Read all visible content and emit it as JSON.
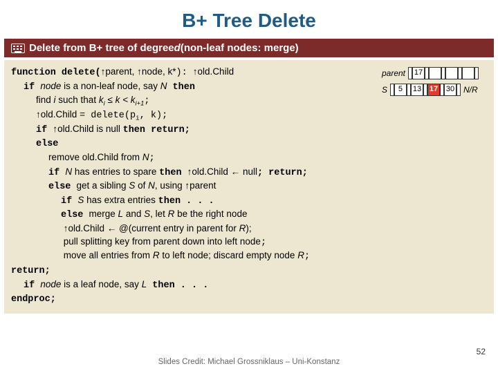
{
  "title": "B+ Tree Delete",
  "section": {
    "prefix": "Delete from B+ tree of degree ",
    "degree": "d",
    "suffix": " (non-leaf nodes: merge)"
  },
  "code": {
    "l1a": "function delete(",
    "l1b": "↑parent",
    "l1c": ", ",
    "l1d": "↑node",
    "l1e": ", k*",
    "l1f": "): ",
    "l1g": "↑old.Child",
    "l2a": "if ",
    "l2b": "node",
    "l2c": " is a non-leaf node, say ",
    "l2d": "N",
    "l2e": " then",
    "l3a": "find ",
    "l3b": "i",
    "l3c": " such that ",
    "l3d": "kᵢ ≤ k < kᵢ₊₁",
    "l3e": ";",
    "l4a": "↑old.Child ",
    "l4b": "= delete(pᵢ, k);",
    "l5a": "if ",
    "l5b": "↑old.Child is null ",
    "l5c": "then return;",
    "l6a": "else",
    "l7a": "remove old.Child from ",
    "l7b": "N",
    "l7c": ";",
    "l8a": "if ",
    "l8b": "N",
    "l8c": " has entries to spare ",
    "l8d": "then ",
    "l8e": "↑old.Child ← null",
    "l8f": "; return;",
    "l9a": "else ",
    "l9b": "get a sibling ",
    "l9c": "S",
    "l9d": " of ",
    "l9e": "N",
    "l9f": ", using ↑parent",
    "l10a": "if ",
    "l10b": "S",
    "l10c": " has extra entries ",
    "l10d": "then . . .",
    "l11a": "else ",
    "l11b": "merge ",
    "l11c": "L",
    "l11d": " and ",
    "l11e": "S",
    "l11f": ", let ",
    "l11g": "R",
    "l11h": " be the right node",
    "l12a": "↑old.Child ← @(current entry in parent for ",
    "l12b": "R",
    "l12c": ");",
    "l13a": "pull splitting key from parent down into left node",
    "l13b": ";",
    "l14a": "move all entries from ",
    "l14b": "R",
    "l14c": " to left node; discard empty node ",
    "l14d": "R",
    "l14e": ";",
    "l15": "return;",
    "l16a": "if ",
    "l16b": "node",
    "l16c": " is a leaf node, say ",
    "l16d": "L",
    "l16e": " then . . .",
    "l17": "endproc;"
  },
  "diagram": {
    "parentLabel": "parent",
    "parentValues": [
      "17",
      "",
      "",
      ""
    ],
    "sLabel": "S",
    "sValues": [
      "5",
      "13",
      "17",
      "30"
    ],
    "nrLabel": "N/R",
    "redIndex": 2
  },
  "credit": "Slides Credit: Michael Grossniklaus – Uni-Konstanz",
  "pageNum": "52"
}
